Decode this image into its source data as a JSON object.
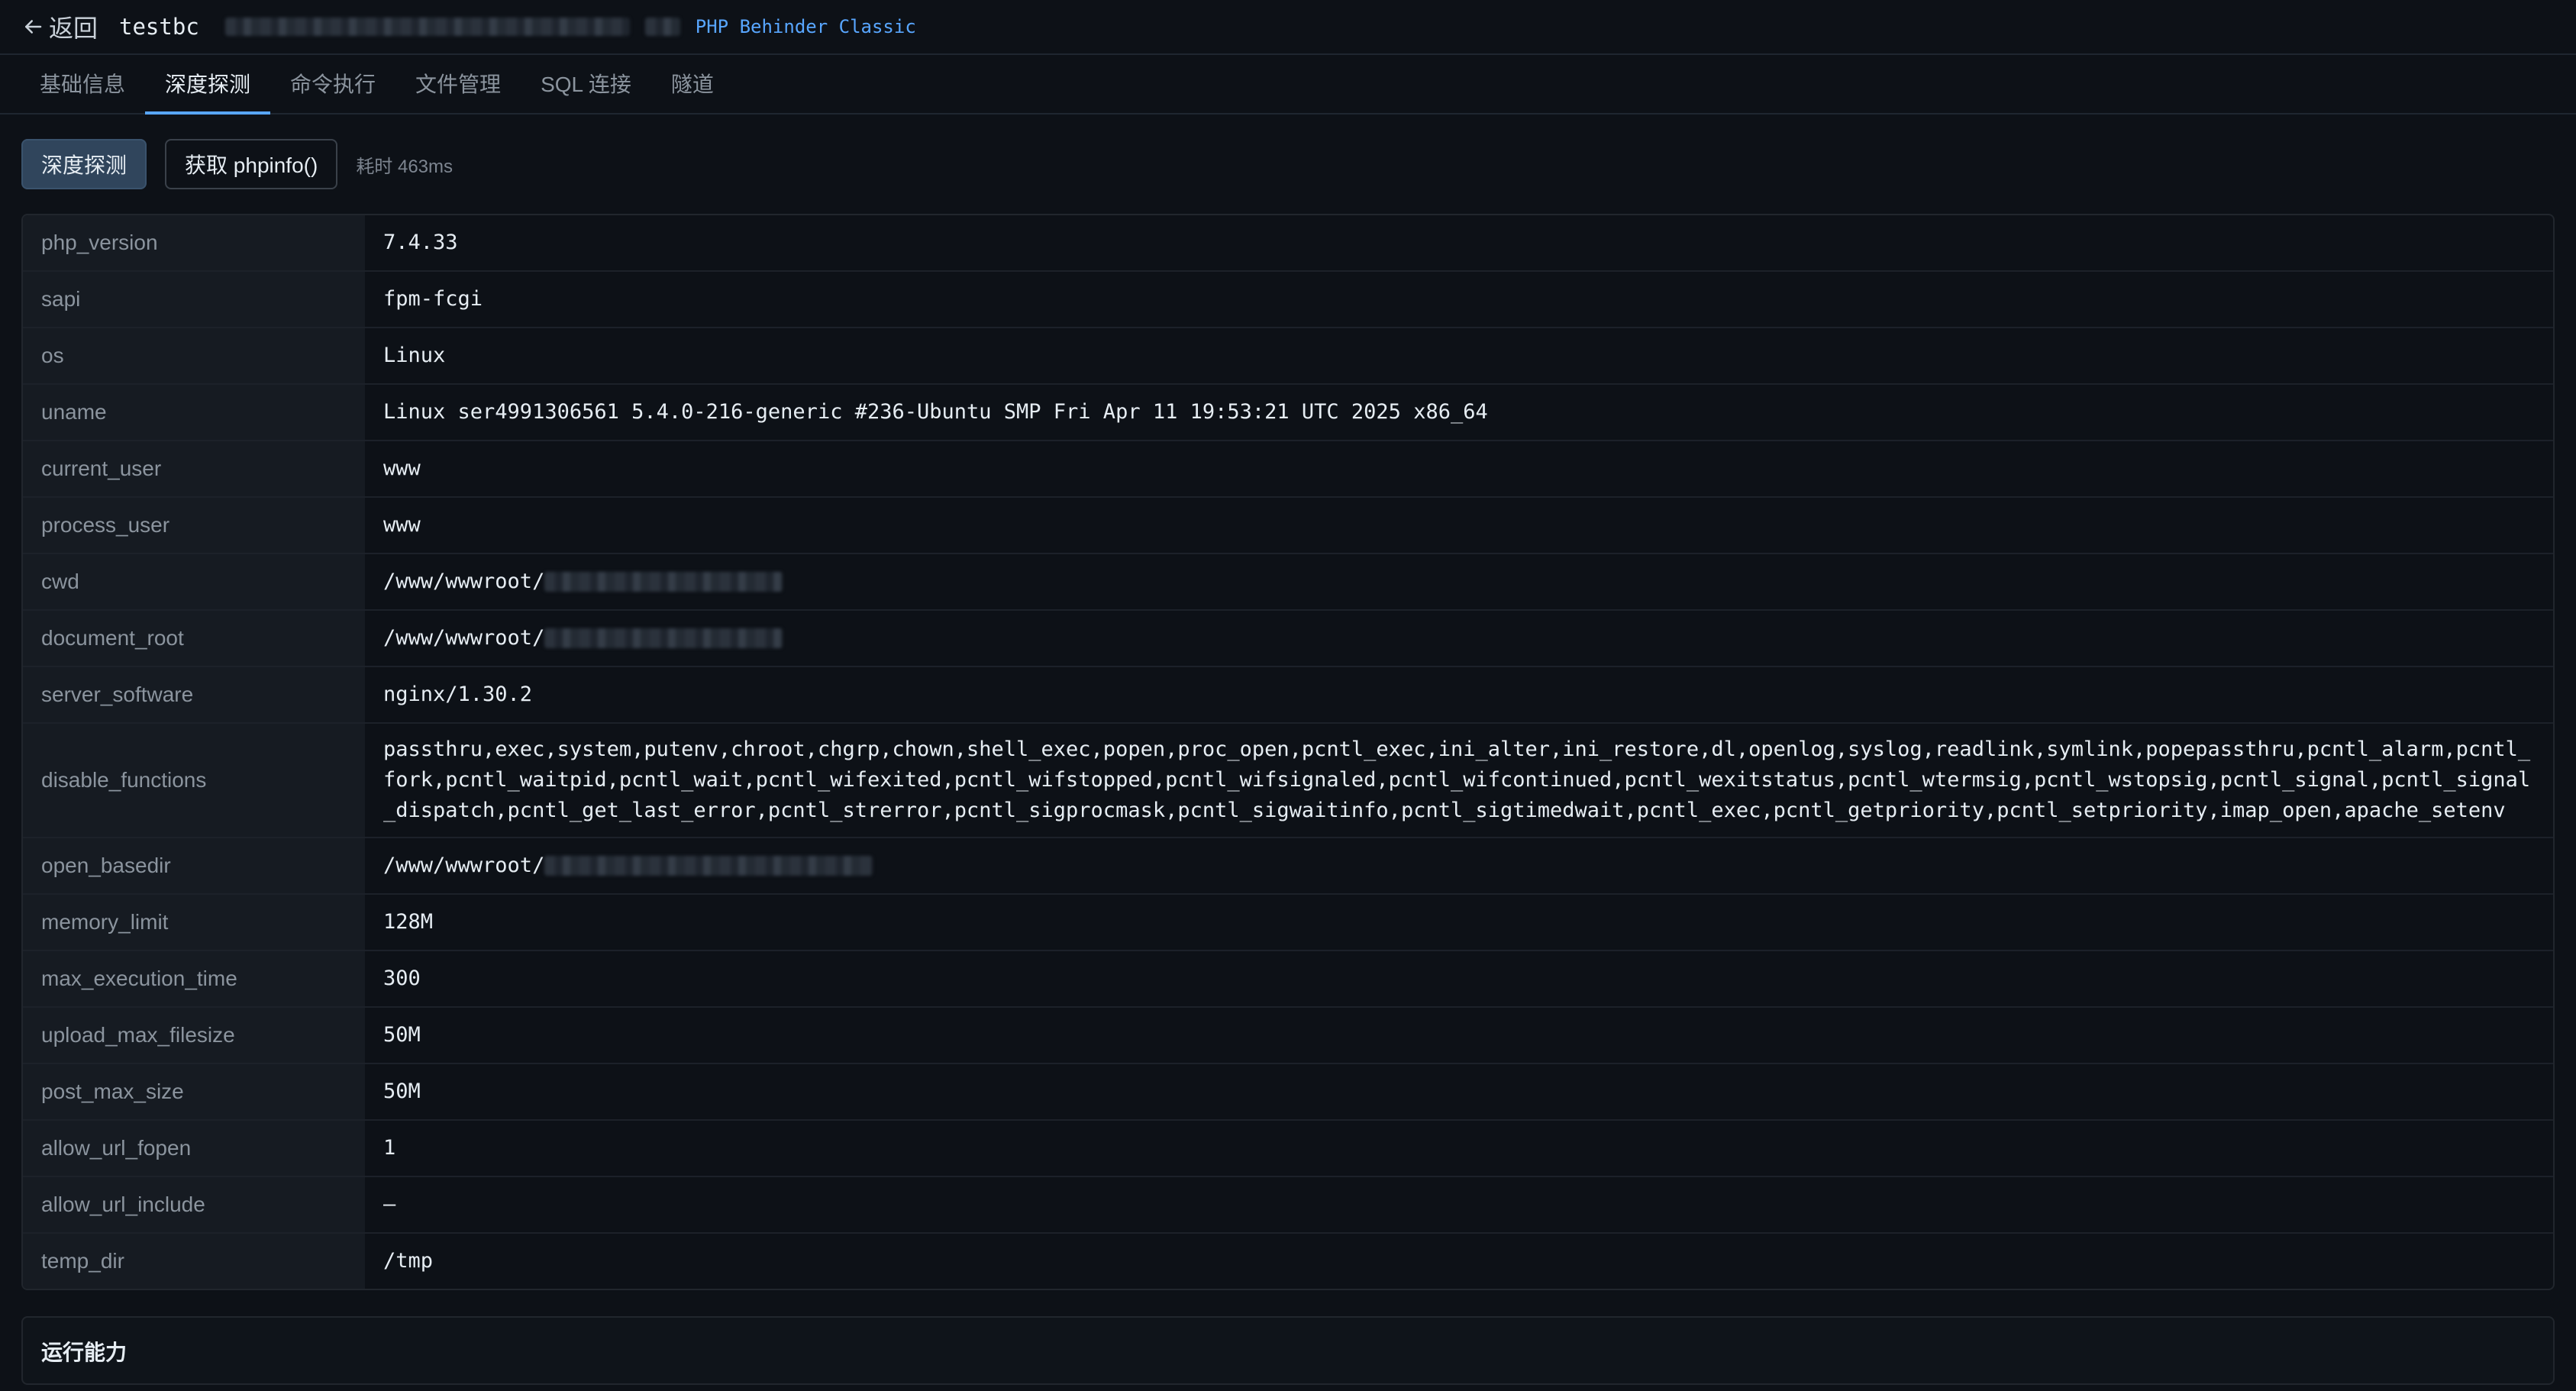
{
  "header": {
    "back_label": "返回",
    "connection_name": "testbc",
    "protocol": "PHP Behinder Classic"
  },
  "tabs": [
    {
      "label": "基础信息",
      "active": false
    },
    {
      "label": "深度探测",
      "active": true
    },
    {
      "label": "命令执行",
      "active": false
    },
    {
      "label": "文件管理",
      "active": false
    },
    {
      "label": "SQL 连接",
      "active": false
    },
    {
      "label": "隧道",
      "active": false
    }
  ],
  "toolbar": {
    "probe_label": "深度探测",
    "phpinfo_label": "获取 phpinfo()",
    "elapsed": "耗时 463ms"
  },
  "info_rows": [
    {
      "key": "php_version",
      "value": "7.4.33"
    },
    {
      "key": "sapi",
      "value": "fpm-fcgi"
    },
    {
      "key": "os",
      "value": "Linux"
    },
    {
      "key": "uname",
      "value": "Linux ser4991306561 5.4.0-216-generic #236-Ubuntu SMP Fri Apr 11 19:53:21 UTC 2025 x86_64"
    },
    {
      "key": "current_user",
      "value": "www"
    },
    {
      "key": "process_user",
      "value": "www"
    },
    {
      "key": "cwd",
      "value": "/www/wwwroot/"
    },
    {
      "key": "document_root",
      "value": "/www/wwwroot/"
    },
    {
      "key": "server_software",
      "value": "nginx/1.30.2"
    },
    {
      "key": "disable_functions",
      "value": "passthru,exec,system,putenv,chroot,chgrp,chown,shell_exec,popen,proc_open,pcntl_exec,ini_alter,ini_restore,dl,openlog,syslog,readlink,symlink,popepassthru,pcntl_alarm,pcntl_fork,pcntl_waitpid,pcntl_wait,pcntl_wifexited,pcntl_wifstopped,pcntl_wifsignaled,pcntl_wifcontinued,pcntl_wexitstatus,pcntl_wtermsig,pcntl_wstopsig,pcntl_signal,pcntl_signal_dispatch,pcntl_get_last_error,pcntl_strerror,pcntl_sigprocmask,pcntl_sigwaitinfo,pcntl_sigtimedwait,pcntl_exec,pcntl_getpriority,pcntl_setpriority,imap_open,apache_setenv"
    },
    {
      "key": "open_basedir",
      "value": "/www/wwwroot/"
    },
    {
      "key": "memory_limit",
      "value": "128M"
    },
    {
      "key": "max_execution_time",
      "value": "300"
    },
    {
      "key": "upload_max_filesize",
      "value": "50M"
    },
    {
      "key": "post_max_size",
      "value": "50M"
    },
    {
      "key": "allow_url_fopen",
      "value": "1"
    },
    {
      "key": "allow_url_include",
      "value": "–"
    },
    {
      "key": "temp_dir",
      "value": "/tmp"
    }
  ],
  "section": {
    "title": "运行能力"
  },
  "colors": {
    "background": "#0d1117",
    "accent": "#58a6ff",
    "key_column": "#161b22"
  }
}
